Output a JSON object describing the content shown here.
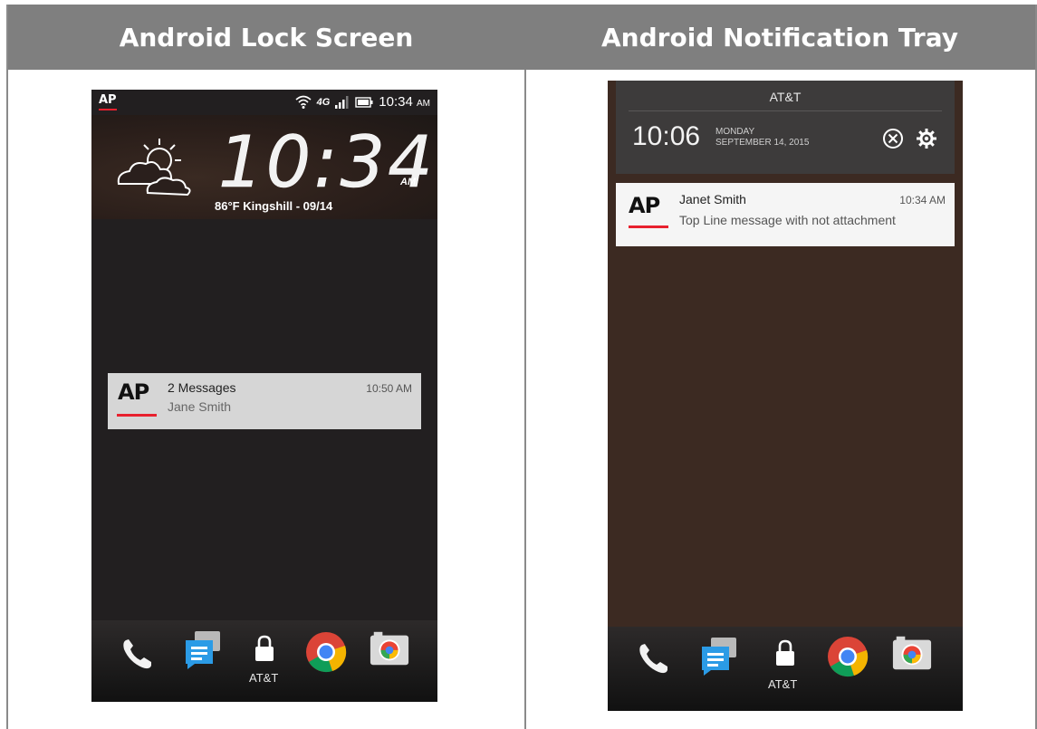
{
  "headers": {
    "left": "Android Lock Screen",
    "right": "Android Notification Tray"
  },
  "lock_screen": {
    "status_bar": {
      "app_badge": "AP",
      "network": "4G LTE",
      "time": "10:34",
      "time_suffix": "AM"
    },
    "clock": {
      "time": "10:34",
      "ampm": "AM"
    },
    "weather_line": "86°F Kingshill - 09/14",
    "notification": {
      "logo": "AP",
      "title": "2 Messages",
      "subtitle": "Jane Smith",
      "time": "10:50 AM"
    },
    "dock": {
      "carrier": "AT&T",
      "apps": [
        "phone-icon",
        "messages-icon",
        "lock-icon",
        "chrome-icon",
        "camera-icon"
      ]
    }
  },
  "notification_tray": {
    "carrier": "AT&T",
    "time": "10:06",
    "day": "MONDAY",
    "date": "SEPTEMBER 14, 2015",
    "notification": {
      "logo": "AP",
      "title": "Janet Smith",
      "subtitle": "Top Line message with not attachment",
      "time": "10:34 AM"
    },
    "dock": {
      "carrier": "AT&T",
      "apps": [
        "phone-icon",
        "messages-icon",
        "lock-icon",
        "chrome-icon",
        "camera-icon"
      ]
    }
  },
  "colors": {
    "header_bg": "#7f7f7f",
    "ap_red": "#e8212e",
    "lock_bg": "#221f20",
    "tray_bg": "#3c2a22"
  }
}
